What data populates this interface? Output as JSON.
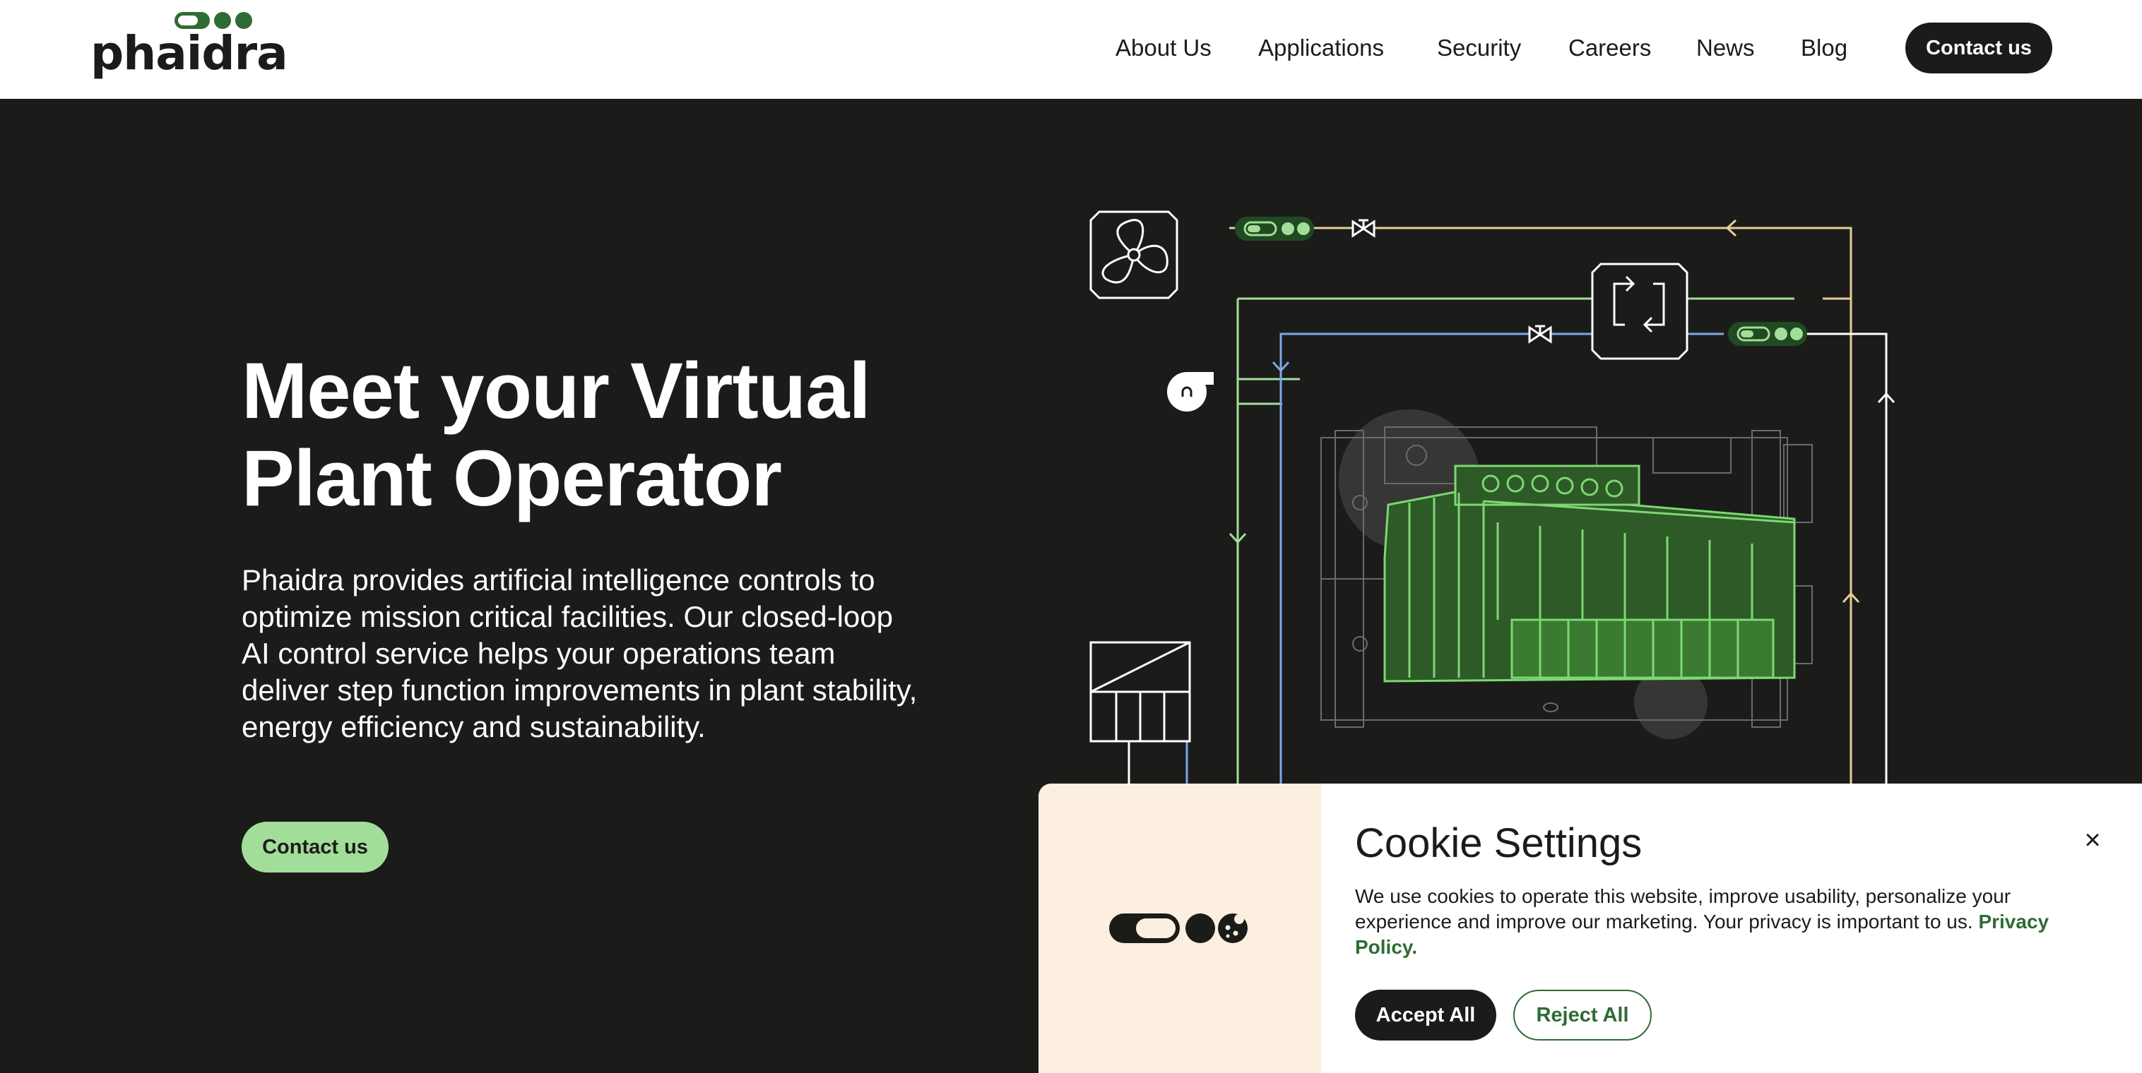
{
  "brand": {
    "name": "phaidra",
    "colors": {
      "dark": "#1b1c1a",
      "green": "#a3dd9a",
      "brand_green": "#2f6b35",
      "cream": "#fcefdf"
    }
  },
  "nav": {
    "items": [
      "About Us",
      "Applications",
      "Security",
      "Careers",
      "News",
      "Blog"
    ],
    "cta": "Contact us"
  },
  "hero": {
    "title_line1": "Meet your Virtual",
    "title_line2": "Plant Operator",
    "description": "Phaidra provides artificial intelligence controls to optimize mission critical facilities. Our closed-loop AI control service helps your operations team deliver step function improvements in plant stability, energy efficiency and sustainability.",
    "cta": "Contact us"
  },
  "diagram": {
    "icons": [
      "fan-icon",
      "pump-icon",
      "valve-icon",
      "heat-exchanger-icon",
      "chiller-icon",
      "cooling-tower-icon",
      "status-toggle-icon"
    ]
  },
  "cookie": {
    "title": "Cookie Settings",
    "close_icon": "close-icon",
    "text": "We use cookies to operate this website, improve usability, personalize your experience and improve our marketing. Your privacy is important to us.",
    "link": "Privacy Policy.",
    "accept": "Accept All",
    "reject": "Reject All"
  }
}
